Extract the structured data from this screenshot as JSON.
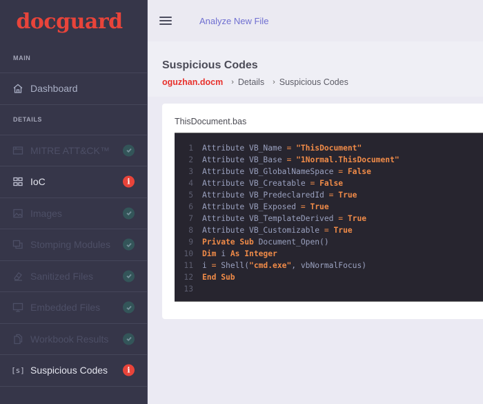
{
  "sidebar": {
    "logo": "docguard",
    "sections": {
      "main": "MAIN",
      "details": "DETAILS"
    },
    "main_items": [
      {
        "label": "Dashboard",
        "icon": "home-icon"
      }
    ],
    "detail_items": [
      {
        "label": "MITRE ATT&CK™",
        "icon": "window-icon",
        "status": "ok",
        "enabled": false
      },
      {
        "label": "IoC",
        "icon": "grid-icon",
        "status": "warning",
        "enabled": true
      },
      {
        "label": "Images",
        "icon": "image-icon",
        "status": "ok",
        "enabled": false
      },
      {
        "label": "Stomping Modules",
        "icon": "copy-icon",
        "status": "ok",
        "enabled": false
      },
      {
        "label": "Sanitized Files",
        "icon": "eraser-icon",
        "status": "ok",
        "enabled": false
      },
      {
        "label": "Embedded Files",
        "icon": "monitor-icon",
        "status": "ok",
        "enabled": false
      },
      {
        "label": "Workbook Results",
        "icon": "files-icon",
        "status": "ok",
        "enabled": false
      },
      {
        "label": "Suspicious Codes",
        "icon": "code-brackets-icon",
        "icon_text": "[s]",
        "status": "warning",
        "enabled": true
      }
    ],
    "badge_ok_glyph": "✓",
    "badge_warn_glyph": "i"
  },
  "topbar": {
    "analyze_link": "Analyze New File"
  },
  "page": {
    "title": "Suspicious Codes",
    "breadcrumb": {
      "file": "oguzhan.docm",
      "separator": "›",
      "items": [
        "Details",
        "Suspicious Codes"
      ]
    }
  },
  "card": {
    "filename": "ThisDocument.bas",
    "code_lines": [
      {
        "n": "1",
        "tokens": [
          [
            "plain",
            "Attribute VB_Name "
          ],
          [
            "op",
            "="
          ],
          [
            "plain",
            " "
          ],
          [
            "str",
            "\"ThisDocument\""
          ]
        ]
      },
      {
        "n": "2",
        "tokens": [
          [
            "plain",
            "Attribute VB_Base "
          ],
          [
            "op",
            "="
          ],
          [
            "plain",
            " "
          ],
          [
            "str",
            "\"1Normal.ThisDocument\""
          ]
        ]
      },
      {
        "n": "3",
        "tokens": [
          [
            "plain",
            "Attribute VB_GlobalNameSpace "
          ],
          [
            "op",
            "="
          ],
          [
            "plain",
            " "
          ],
          [
            "kw",
            "False"
          ]
        ]
      },
      {
        "n": "4",
        "tokens": [
          [
            "plain",
            "Attribute VB_Creatable "
          ],
          [
            "op",
            "="
          ],
          [
            "plain",
            " "
          ],
          [
            "kw",
            "False"
          ]
        ]
      },
      {
        "n": "5",
        "tokens": [
          [
            "plain",
            "Attribute VB_PredeclaredId "
          ],
          [
            "op",
            "="
          ],
          [
            "plain",
            " "
          ],
          [
            "kw",
            "True"
          ]
        ]
      },
      {
        "n": "6",
        "tokens": [
          [
            "plain",
            "Attribute VB_Exposed "
          ],
          [
            "op",
            "="
          ],
          [
            "plain",
            " "
          ],
          [
            "kw",
            "True"
          ]
        ]
      },
      {
        "n": "7",
        "tokens": [
          [
            "plain",
            "Attribute VB_TemplateDerived "
          ],
          [
            "op",
            "="
          ],
          [
            "plain",
            " "
          ],
          [
            "kw",
            "True"
          ]
        ]
      },
      {
        "n": "8",
        "tokens": [
          [
            "plain",
            "Attribute VB_Customizable "
          ],
          [
            "op",
            "="
          ],
          [
            "plain",
            " "
          ],
          [
            "kw",
            "True"
          ]
        ]
      },
      {
        "n": "9",
        "tokens": [
          [
            "kw",
            "Private Sub"
          ],
          [
            "plain",
            " Document_Open()"
          ]
        ]
      },
      {
        "n": "10",
        "tokens": [
          [
            "kw",
            "Dim"
          ],
          [
            "plain",
            " i "
          ],
          [
            "kw",
            "As Integer"
          ]
        ]
      },
      {
        "n": "11",
        "tokens": [
          [
            "plain",
            "i "
          ],
          [
            "op",
            "="
          ],
          [
            "plain",
            " Shell("
          ],
          [
            "str",
            "\"cmd.exe\""
          ],
          [
            "plain",
            ", vbNormalFocus)"
          ]
        ]
      },
      {
        "n": "12",
        "tokens": [
          [
            "kw",
            "End Sub"
          ]
        ]
      },
      {
        "n": "13",
        "tokens": []
      }
    ]
  },
  "colors": {
    "brand": "#e8443a",
    "sidebar_bg": "#363649",
    "link": "#6f6fd1",
    "code_bg": "#27252f",
    "code_keyword": "#f08b48"
  }
}
